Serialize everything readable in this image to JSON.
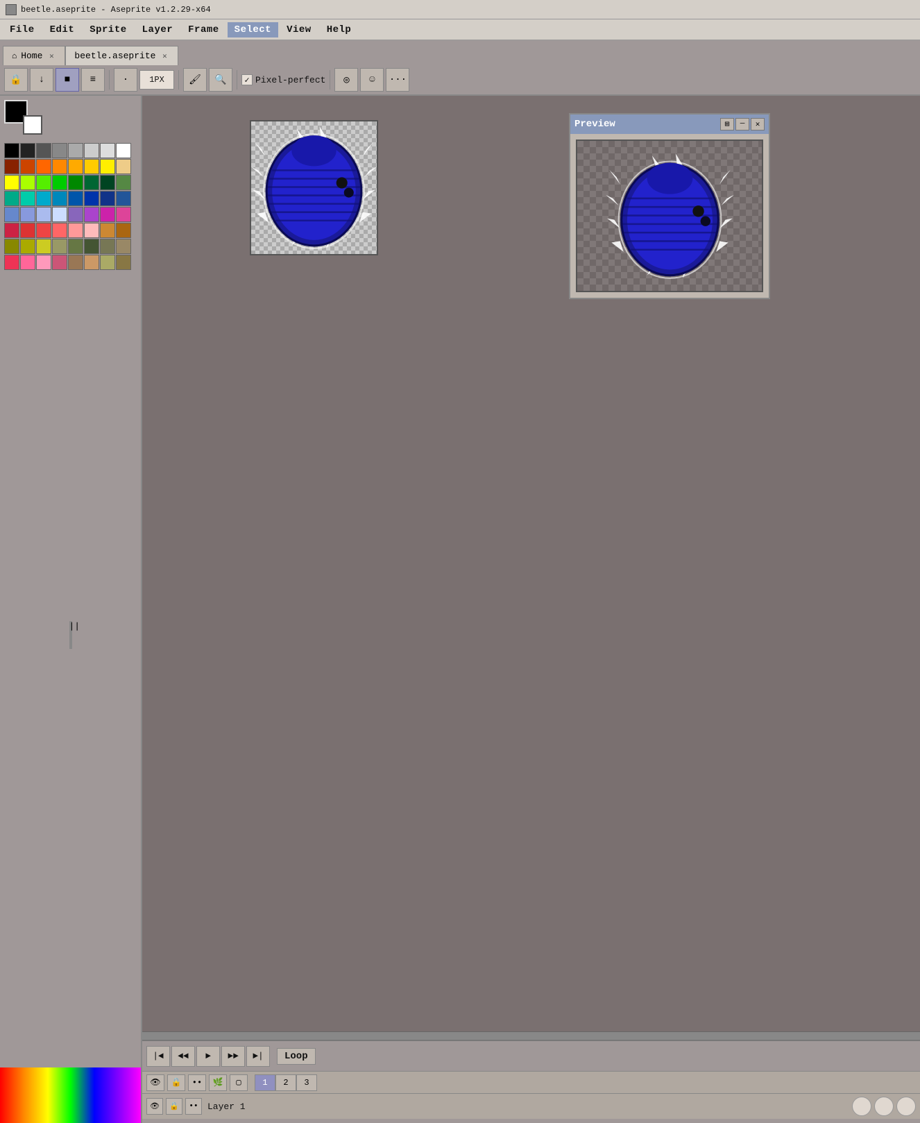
{
  "window": {
    "title": "beetle.aseprite - Aseprite v1.2.29-x64",
    "app_icon": "beetle-icon"
  },
  "menu": {
    "items": [
      "File",
      "Edit",
      "Sprite",
      "Layer",
      "Frame",
      "Select",
      "View",
      "Help"
    ],
    "active": "Select"
  },
  "tabs": [
    {
      "id": "home",
      "label": "Home",
      "icon": "home-icon",
      "closable": true,
      "active": false
    },
    {
      "id": "beetle",
      "label": "beetle.aseprite",
      "icon": null,
      "closable": true,
      "active": true
    }
  ],
  "toolbar": {
    "brush_size": "1PX",
    "pixel_perfect_label": "Pixel-perfect",
    "pixel_perfect_checked": true
  },
  "palette": {
    "colors": [
      "#000000",
      "#222222",
      "#555555",
      "#888888",
      "#aaaaaa",
      "#cccccc",
      "#dddddd",
      "#ffffff",
      "#882200",
      "#cc4400",
      "#ff6600",
      "#ff8800",
      "#ffaa00",
      "#ffcc00",
      "#ffee00",
      "#eecc88",
      "#ffff00",
      "#aaff00",
      "#55ee00",
      "#00cc00",
      "#008800",
      "#006633",
      "#004422",
      "#558844",
      "#00aa88",
      "#00ccaa",
      "#00aacc",
      "#0088bb",
      "#0055aa",
      "#0033aa",
      "#113388",
      "#225599",
      "#6688cc",
      "#8899dd",
      "#aabbee",
      "#ccddff",
      "#8866bb",
      "#aa44cc",
      "#cc22aa",
      "#dd4499",
      "#cc2244",
      "#dd3333",
      "#ee4444",
      "#ff6666",
      "#ff9999",
      "#ffbbbb",
      "#cc8833",
      "#aa6611",
      "#888800",
      "#aaaa00",
      "#cccc22",
      "#999966",
      "#667744",
      "#445533",
      "#777755",
      "#998866",
      "#ee3355",
      "#ff6699",
      "#ff99bb",
      "#cc5577",
      "#997755",
      "#cc9966",
      "#aaaa66",
      "#887744"
    ],
    "fg_color": "#000000",
    "bg_color": "#ffffff"
  },
  "preview": {
    "title": "Preview",
    "buttons": [
      "maximize-icon",
      "minimize-icon",
      "close-icon"
    ]
  },
  "timeline": {
    "loop_label": "Loop",
    "playback_buttons": [
      {
        "id": "first-frame",
        "icon": "⏮",
        "label": "First Frame"
      },
      {
        "id": "prev-frame",
        "icon": "◄◄",
        "label": "Prev Frame"
      },
      {
        "id": "play",
        "icon": "►",
        "label": "Play"
      },
      {
        "id": "next-frame",
        "icon": "►►",
        "label": "Next Frame"
      },
      {
        "id": "last-frame",
        "icon": "⏭",
        "label": "Last Frame"
      }
    ],
    "frame_numbers": [
      "1",
      "2",
      "3"
    ],
    "active_frame": 1,
    "layer": {
      "name": "Layer 1",
      "visible": true,
      "locked": false
    }
  },
  "canvas": {
    "scroll_handle": "||"
  }
}
